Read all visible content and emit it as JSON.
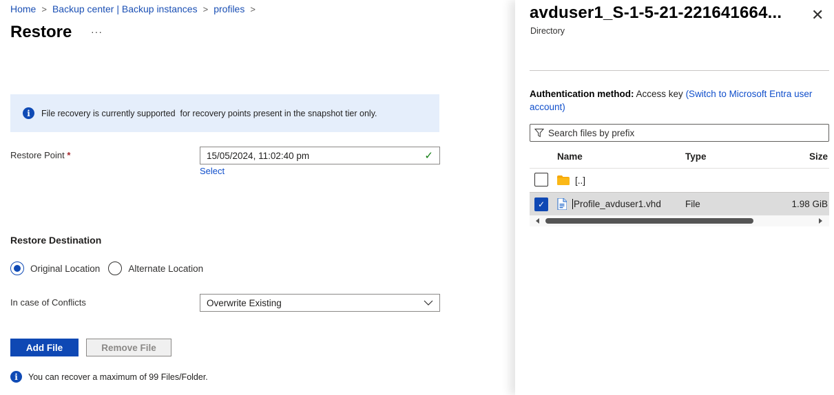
{
  "breadcrumb": [
    "Home",
    "Backup center | Backup instances",
    "profiles"
  ],
  "page": {
    "title": "Restore",
    "more_label": "···"
  },
  "info_banner": {
    "icon": "info-icon",
    "text": "File recovery is currently supported  for recovery points present in the snapshot tier only."
  },
  "restore_point": {
    "label": "Restore Point",
    "required_marker": "*",
    "value": "15/05/2024, 11:02:40 pm",
    "valid_icon": "✓",
    "select_link": "Select"
  },
  "destination": {
    "title": "Restore Destination",
    "options": [
      {
        "label": "Original Location",
        "checked": true
      },
      {
        "label": "Alternate Location",
        "checked": false
      }
    ]
  },
  "conflicts": {
    "label": "In case of Conflicts",
    "value": "Overwrite Existing"
  },
  "buttons": {
    "add_file": "Add File",
    "remove_file": "Remove File"
  },
  "note": {
    "text": "You can recover a maximum of 99 Files/Folder."
  },
  "panel": {
    "title": "avduser1_S-1-5-21-221641664...",
    "subtitle": "Directory",
    "close_label": "✕",
    "auth_label": "Authentication method:",
    "auth_value": "Access key",
    "auth_link": "(Switch to Microsoft Entra user account)",
    "search_placeholder": "Search files by prefix",
    "columns": {
      "name": "Name",
      "type": "Type",
      "size": "Size"
    },
    "rows": [
      {
        "name": "[..]",
        "type": "",
        "size": "",
        "icon": "folder-icon",
        "checked": false
      },
      {
        "name": "Profile_avduser1.vhd",
        "type": "File",
        "size": "1.98 GiB",
        "icon": "file-icon",
        "checked": true
      }
    ]
  }
}
